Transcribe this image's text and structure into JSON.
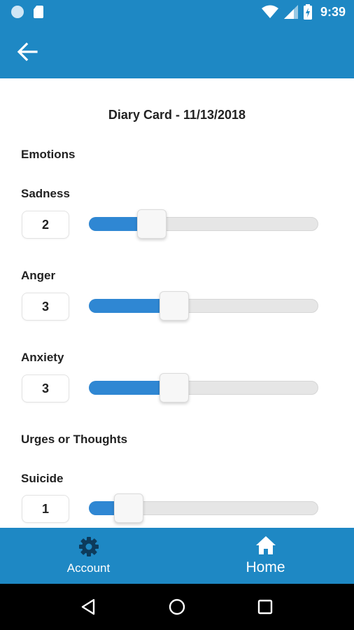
{
  "status_bar": {
    "time": "9:39",
    "icons": [
      "circle-notification-icon",
      "sd-card-icon",
      "wifi-icon",
      "cell-signal-icon",
      "battery-charging-icon"
    ]
  },
  "app_bar": {
    "back_icon": "arrow-left-icon"
  },
  "card": {
    "title": "Diary Card - 11/13/2018",
    "sections": [
      {
        "label": "Emotions",
        "items": [
          {
            "label": "Sadness",
            "value": "2",
            "level": 0.2
          },
          {
            "label": "Anger",
            "value": "3",
            "level": 0.3
          },
          {
            "label": "Anxiety",
            "value": "3",
            "level": 0.3
          }
        ]
      },
      {
        "label": "Urges or Thoughts",
        "items": [
          {
            "label": "Suicide",
            "value": "1",
            "level": 0.1
          }
        ]
      }
    ]
  },
  "colors": {
    "brand": "#1e88c4",
    "slider_fill": "#2f87d3",
    "track": "#e6e6e6"
  },
  "bottom_nav": {
    "account": {
      "label": "Account",
      "icon": "gear-icon"
    },
    "home": {
      "label": "Home",
      "icon": "home-icon"
    }
  },
  "android_nav": [
    "back-triangle-icon",
    "home-circle-icon",
    "recents-square-icon"
  ]
}
